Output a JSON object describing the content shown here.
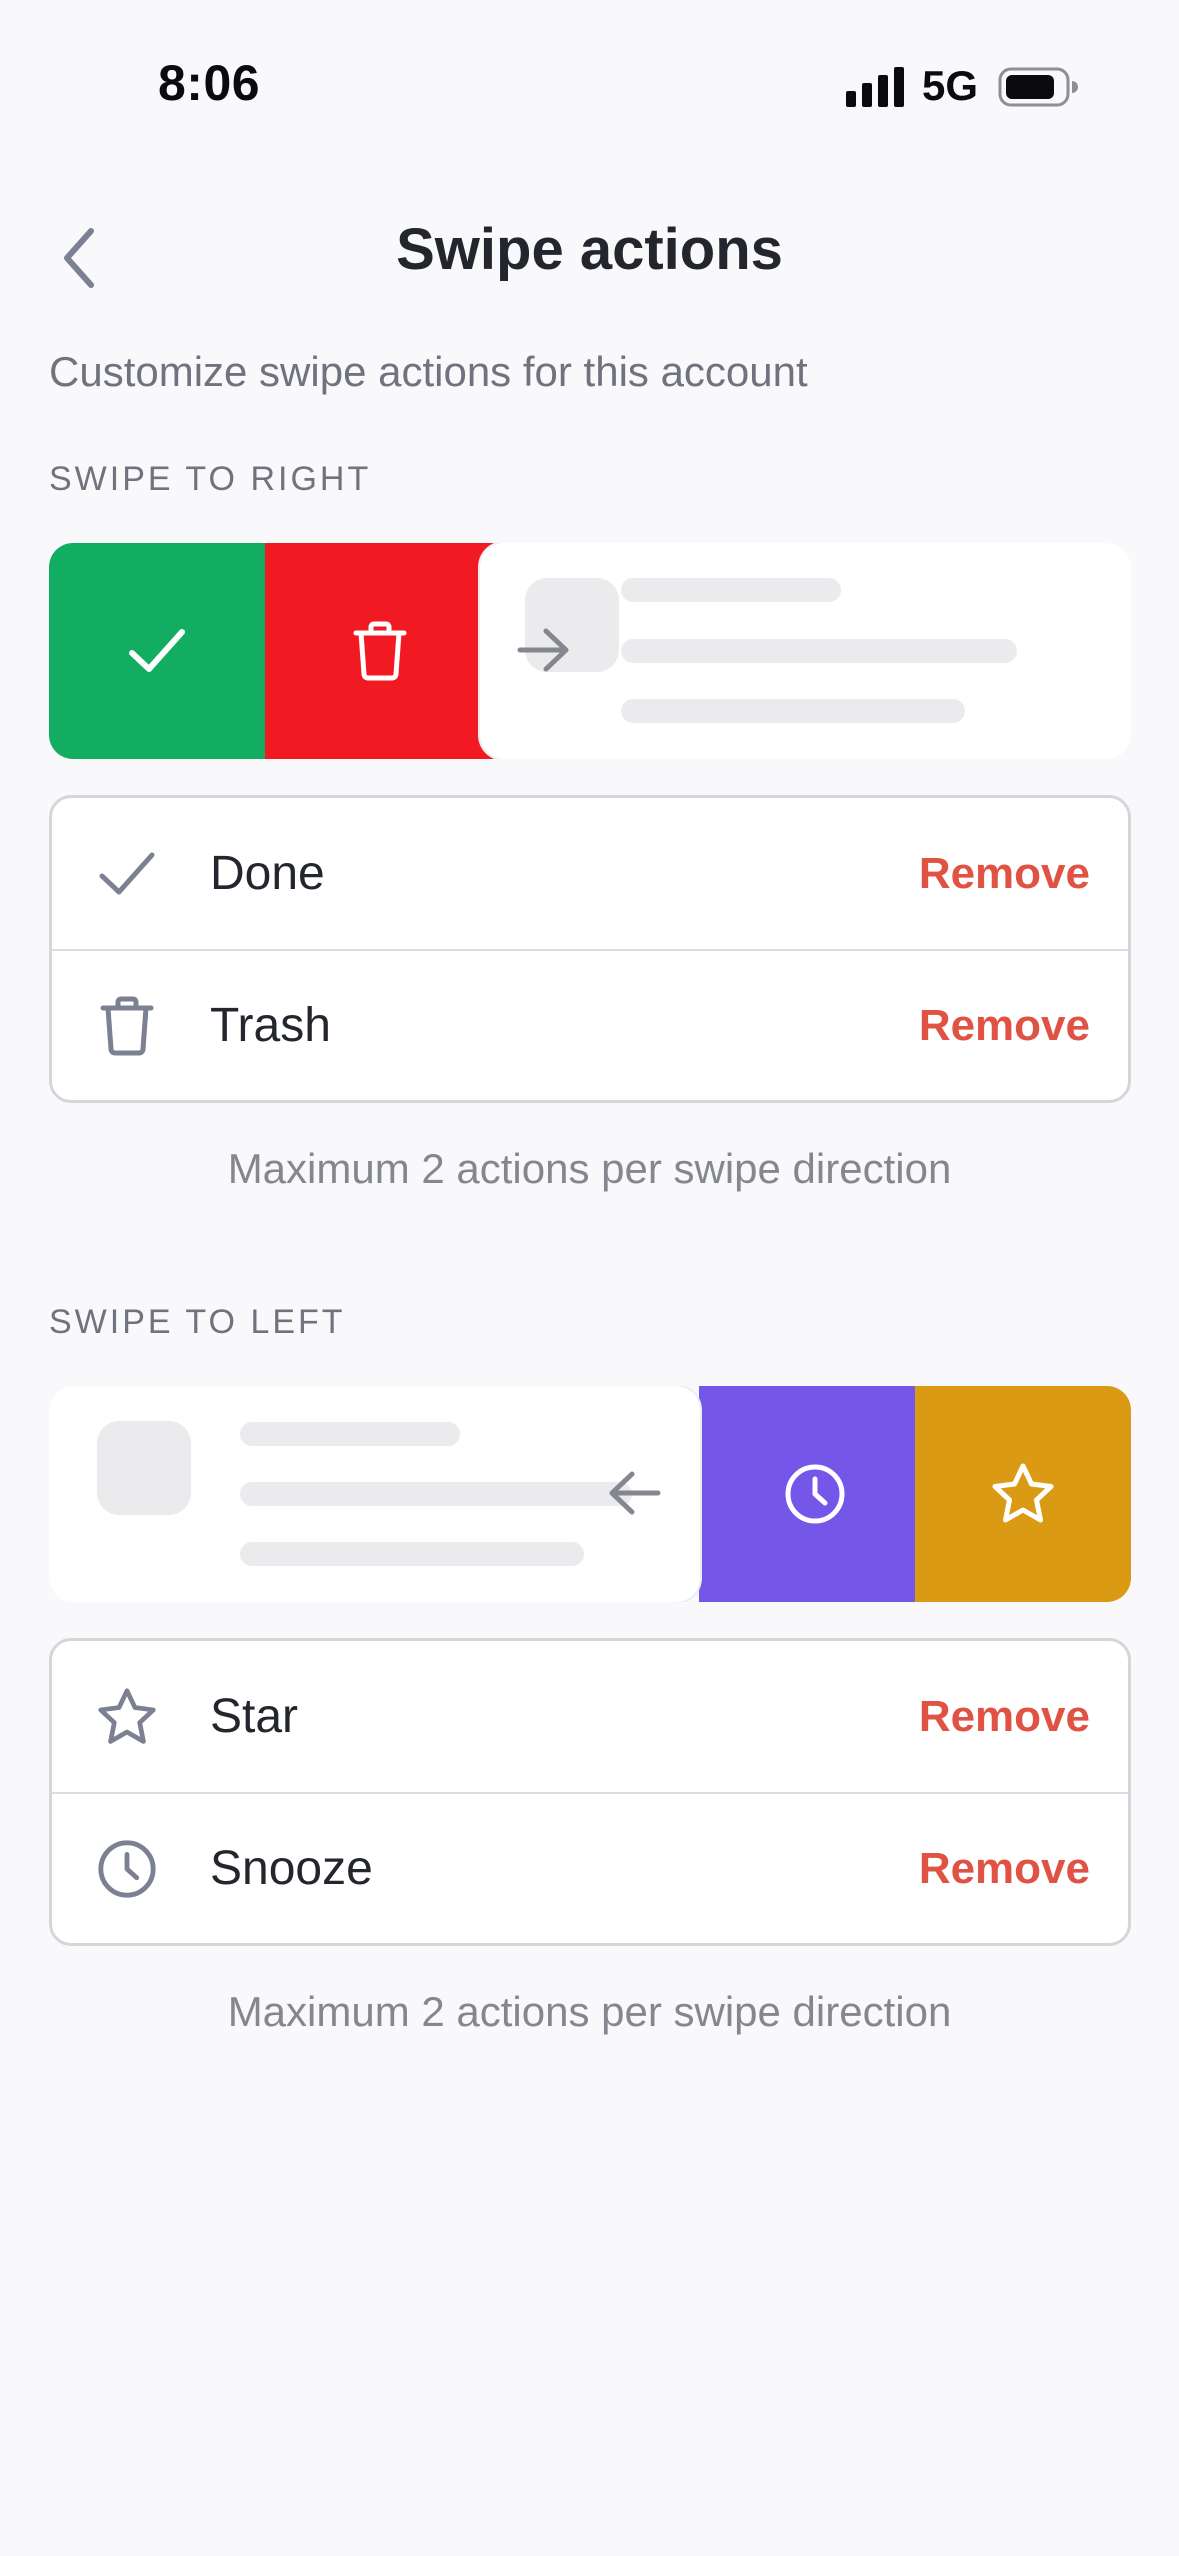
{
  "status_bar": {
    "time": "8:06",
    "network": "5G"
  },
  "nav": {
    "title": "Swipe actions"
  },
  "subtitle": "Customize swipe actions for this account",
  "sections": [
    {
      "label": "SWIPE TO RIGHT",
      "preview_buttons": [
        {
          "icon": "checkmark-icon",
          "color": "#13ad62"
        },
        {
          "icon": "trash-icon",
          "color": "#f11a22"
        }
      ],
      "actions": [
        {
          "icon": "checkmark-icon",
          "label": "Done",
          "remove_label": "Remove"
        },
        {
          "icon": "trash-icon",
          "label": "Trash",
          "remove_label": "Remove"
        }
      ],
      "hint": "Maximum 2 actions per swipe direction"
    },
    {
      "label": "SWIPE TO LEFT",
      "preview_buttons": [
        {
          "icon": "clock-icon",
          "color": "#7457e8"
        },
        {
          "icon": "star-icon",
          "color": "#db9a14"
        }
      ],
      "actions": [
        {
          "icon": "star-icon",
          "label": "Star",
          "remove_label": "Remove"
        },
        {
          "icon": "clock-icon",
          "label": "Snooze",
          "remove_label": "Remove"
        }
      ],
      "hint": "Maximum 2 actions per swipe direction"
    }
  ]
}
